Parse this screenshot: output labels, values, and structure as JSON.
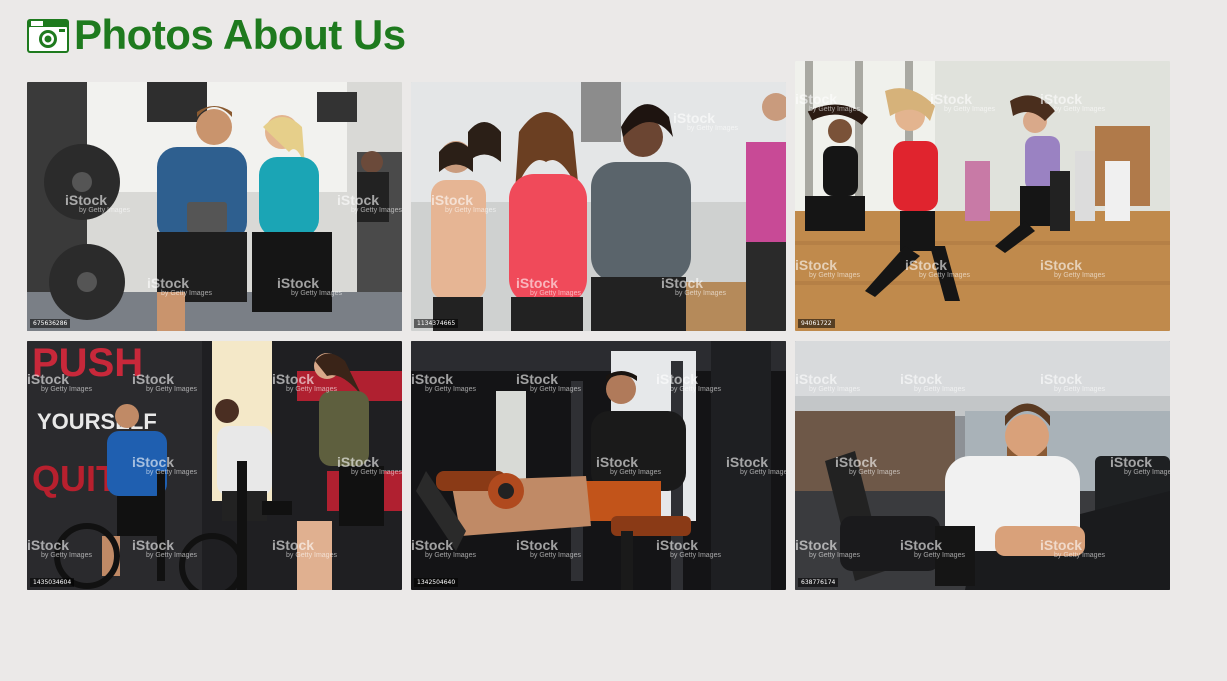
{
  "header": {
    "title": "Photos About Us",
    "icon": "camera-icon",
    "color": "#1e7a1e"
  },
  "watermark": {
    "brand": "iStock",
    "credit": "by Getty Images"
  },
  "photos": [
    {
      "id": "675636286",
      "subject": "gym-couple-tablet"
    },
    {
      "id": "1134374665",
      "subject": "dance-class-laughing"
    },
    {
      "id": "94061722",
      "subject": "dance-studio-jumping"
    },
    {
      "id": "1435034604",
      "subject": "spin-bikes-class"
    },
    {
      "id": "1342504640",
      "subject": "leg-extension-machine"
    },
    {
      "id": "638776174",
      "subject": "treadmill-smiling-man"
    }
  ]
}
